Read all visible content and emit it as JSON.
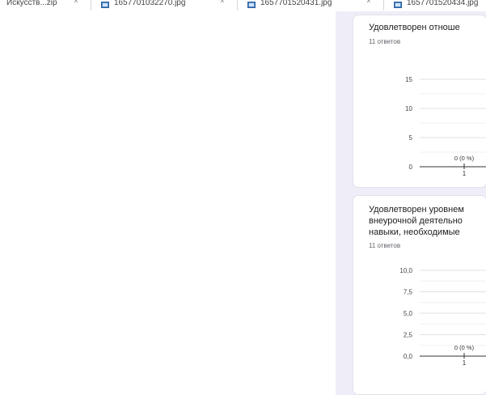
{
  "downloads": [
    {
      "name": "Искусств...zip",
      "caret": "^"
    },
    {
      "name": "1657701032270.jpg",
      "caret": "^"
    },
    {
      "name": "1657701520431.jpg",
      "caret": "^"
    },
    {
      "name": "1657701520434.jpg",
      "caret": ""
    }
  ],
  "cards": [
    {
      "title_lines": [
        "Удовлетворен отноше"
      ],
      "responses": "11 ответов",
      "chart_data": {
        "type": "bar",
        "categories": [
          "1"
        ],
        "values": [
          0
        ],
        "data_labels": [
          "0 (0 %)"
        ],
        "yticks": [
          "0",
          "5",
          "10",
          "15"
        ],
        "ylim": [
          0,
          15
        ],
        "xlabel": "",
        "ylabel": ""
      }
    },
    {
      "title_lines": [
        "Удовлетворен уровнем",
        "внеурочной деятельно",
        "навыки, необходимые"
      ],
      "responses": "11 ответов",
      "chart_data": {
        "type": "bar",
        "categories": [
          "1"
        ],
        "values": [
          0
        ],
        "data_labels": [
          "0 (0 %)"
        ],
        "yticks": [
          "0,0",
          "2,5",
          "5,0",
          "7,5",
          "10,0"
        ],
        "ylim": [
          0,
          10
        ],
        "xlabel": "",
        "ylabel": ""
      }
    }
  ]
}
